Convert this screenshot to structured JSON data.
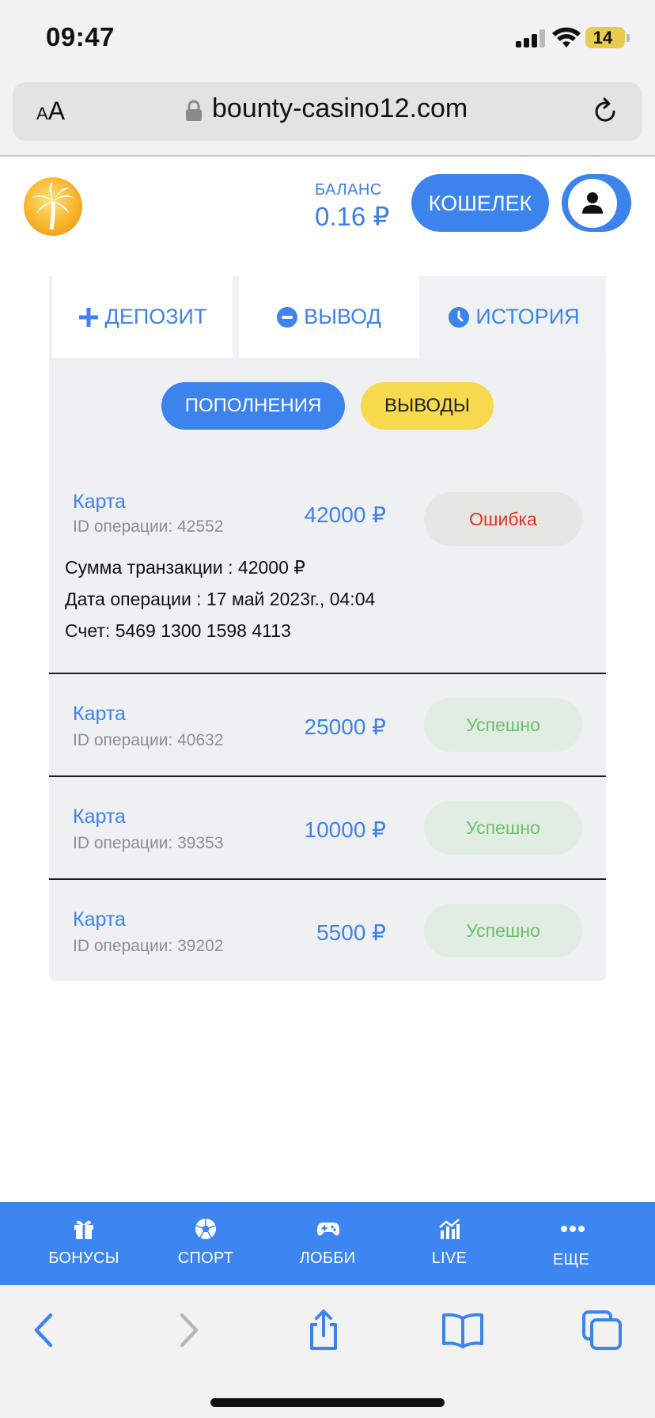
{
  "status_bar": {
    "time": "09:47",
    "battery": "14"
  },
  "browser": {
    "aa_small": "A",
    "aa_large": "A",
    "url": "bounty-casino12.com"
  },
  "header": {
    "balance_label": "БАЛАНС",
    "balance_value": "0.16 ₽",
    "wallet_label": "КОШЕЛЕК"
  },
  "tabs": [
    {
      "label": "ДЕПОЗИТ",
      "icon": "plus-icon"
    },
    {
      "label": "ВЫВОД",
      "icon": "minus-circle-icon"
    },
    {
      "label": "ИСТОРИЯ",
      "icon": "clock-icon"
    }
  ],
  "filters": {
    "deposits": "ПОПОЛНЕНИЯ",
    "withdrawals": "ВЫВОДЫ"
  },
  "transactions": [
    {
      "method": "Карта",
      "id_label": "ID операции: 42552",
      "amount": "42000 ₽",
      "status": "Ошибка",
      "details": {
        "sum_label": "Сумма транзакции :",
        "sum_value": "42000 ₽",
        "date_label": "Дата операции :",
        "date_value": "17 май 2023г., 04:04",
        "account_label": "Счет:",
        "account_value": "5469 1300 1598 4113"
      }
    },
    {
      "method": "Карта",
      "id_label": "ID операции: 40632",
      "amount": "25000 ₽",
      "status": "Успешно"
    },
    {
      "method": "Карта",
      "id_label": "ID операции: 39353",
      "amount": "10000 ₽",
      "status": "Успешно"
    },
    {
      "method": "Карта",
      "id_label": "ID операции: 39202",
      "amount": "5500 ₽",
      "status": "Успешно"
    }
  ],
  "bottom_nav": [
    {
      "label": "БОНУСЫ",
      "icon": "gift-icon"
    },
    {
      "label": "СПОРТ",
      "icon": "soccer-ball-icon"
    },
    {
      "label": "ЛОББИ",
      "icon": "gamepad-icon"
    },
    {
      "label": "LIVE",
      "icon": "live-chart-icon"
    },
    {
      "label": "ЕЩЕ",
      "icon": "more-dots-icon"
    }
  ],
  "colors": {
    "accent": "#3c83ee",
    "yellow": "#f6d94c",
    "error": "#e2332b",
    "success": "#6cc06a"
  }
}
